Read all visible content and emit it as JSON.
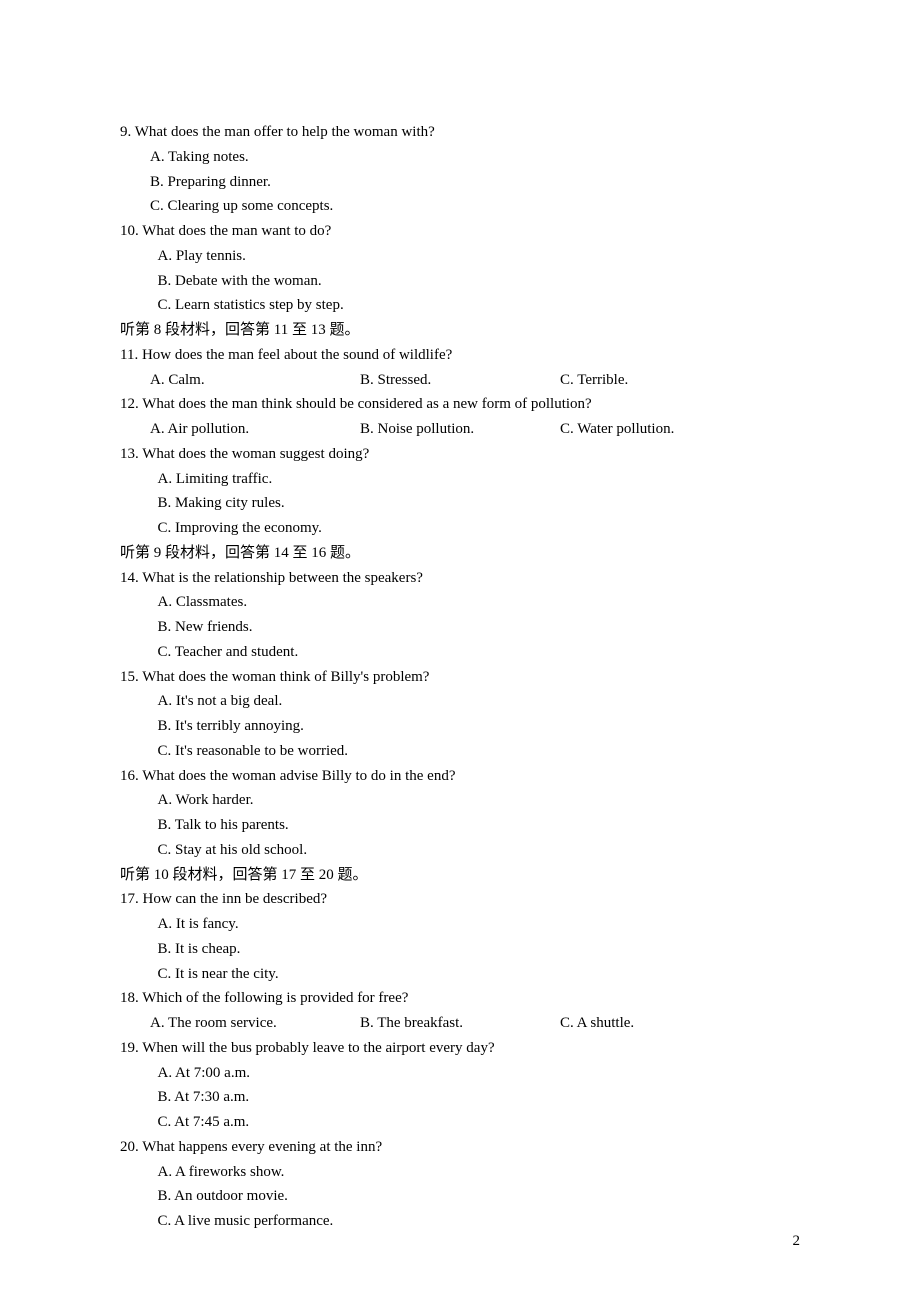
{
  "page_number": "2",
  "content": [
    {
      "type": "question",
      "layout": "stacked",
      "text": "9. What does the man offer to help the woman with?",
      "options": [
        "A. Taking notes.",
        "B. Preparing dinner.",
        "C. Clearing up some concepts."
      ]
    },
    {
      "type": "question",
      "layout": "stacked_wide",
      "text": "10. What does the man want to do?",
      "options": [
        "A. Play tennis.",
        "B. Debate with the woman.",
        "C. Learn statistics step by step."
      ]
    },
    {
      "type": "section",
      "text": "听第 8 段材料，回答第 11 至 13 题。"
    },
    {
      "type": "question",
      "layout": "inline",
      "text": "11. How does the man feel about the sound of wildlife?",
      "options": [
        "A. Calm.",
        "B. Stressed.",
        "C. Terrible."
      ],
      "widths": [
        210,
        200,
        200
      ]
    },
    {
      "type": "question",
      "layout": "inline",
      "text": "12. What does the man think should be considered as a new form of pollution?",
      "options": [
        "A. Air pollution.",
        "B. Noise pollution.",
        "C. Water pollution."
      ],
      "widths": [
        210,
        200,
        200
      ]
    },
    {
      "type": "question",
      "layout": "stacked_wide",
      "text": "13. What does the woman suggest doing?",
      "options": [
        "A. Limiting traffic.",
        "B. Making city rules.",
        "C. Improving the economy."
      ]
    },
    {
      "type": "section",
      "text": "听第 9 段材料，回答第 14 至 16 题。"
    },
    {
      "type": "question",
      "layout": "stacked_wide",
      "text": "14. What is the relationship between the speakers?",
      "options": [
        "A. Classmates.",
        "B. New friends.",
        "C. Teacher and student."
      ]
    },
    {
      "type": "question",
      "layout": "stacked_wide",
      "text": "15. What does the woman think of Billy's problem?",
      "options": [
        "A. It's not a big deal.",
        "B. It's terribly annoying.",
        "C. It's reasonable to be worried."
      ]
    },
    {
      "type": "question",
      "layout": "stacked_wide",
      "text": "16. What does the woman advise Billy to do in the end?",
      "options": [
        "A. Work harder.",
        "B. Talk to his parents.",
        "C. Stay at his old school."
      ]
    },
    {
      "type": "section",
      "text": "听第 10 段材料，回答第 17 至 20 题。"
    },
    {
      "type": "question",
      "layout": "stacked_wide",
      "text": "17. How can the inn be described?",
      "options": [
        "A. It is fancy.",
        "B. It is cheap.",
        "C. It is near the city."
      ]
    },
    {
      "type": "question",
      "layout": "inline",
      "text": "18. Which of the following is provided for free?",
      "options": [
        "A. The room service.",
        "B. The breakfast.",
        "C. A shuttle."
      ],
      "widths": [
        210,
        200,
        200
      ]
    },
    {
      "type": "question",
      "layout": "stacked_wide",
      "text": "19. When will the bus probably leave to the airport every day?",
      "options": [
        "A. At 7:00 a.m.",
        "B. At 7:30 a.m.",
        "C. At 7:45 a.m."
      ]
    },
    {
      "type": "question",
      "layout": "stacked_wide",
      "text": "20. What happens every evening at the inn?",
      "options": [
        "A. A fireworks show.",
        "B. An outdoor movie.",
        "C. A live music performance."
      ]
    }
  ]
}
